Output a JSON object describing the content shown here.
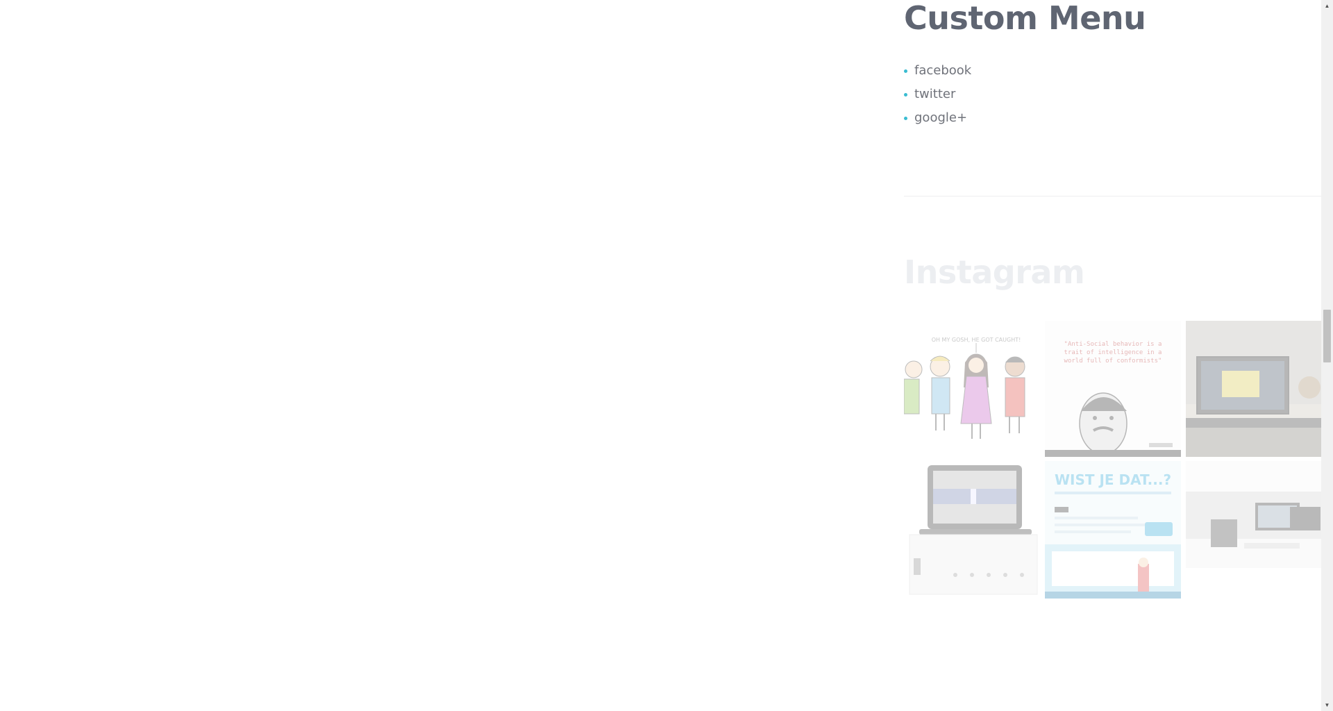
{
  "custom_menu": {
    "title": "Custom Menu",
    "items": [
      {
        "label": "facebook"
      },
      {
        "label": "twitter"
      },
      {
        "label": "google+"
      }
    ]
  },
  "instagram": {
    "title": "Instagram",
    "tiles": [
      {
        "subject": "cartoon-group-image",
        "caption": "OH MY GOSH, HE GOT CAUGHT!"
      },
      {
        "subject": "tesla-quote-image",
        "caption": "\"Anti-Social behavior is a trait of intelligence in a world full of conformists\""
      },
      {
        "subject": "monitor-desk-photo"
      },
      {
        "subject": "laptop-on-stand-photo"
      },
      {
        "subject": "wist-je-dat-poster",
        "caption": "WIST JE DAT...?"
      },
      {
        "subject": "workstation-photo"
      }
    ]
  },
  "colors": {
    "heading": "#5f6572",
    "bullet": "#39bcd1",
    "link": "#6f727a",
    "instagram_heading": "#eceef1"
  },
  "scrollbar": {
    "up_icon": "scroll-up-arrow-icon",
    "down_icon": "scroll-down-arrow-icon"
  }
}
